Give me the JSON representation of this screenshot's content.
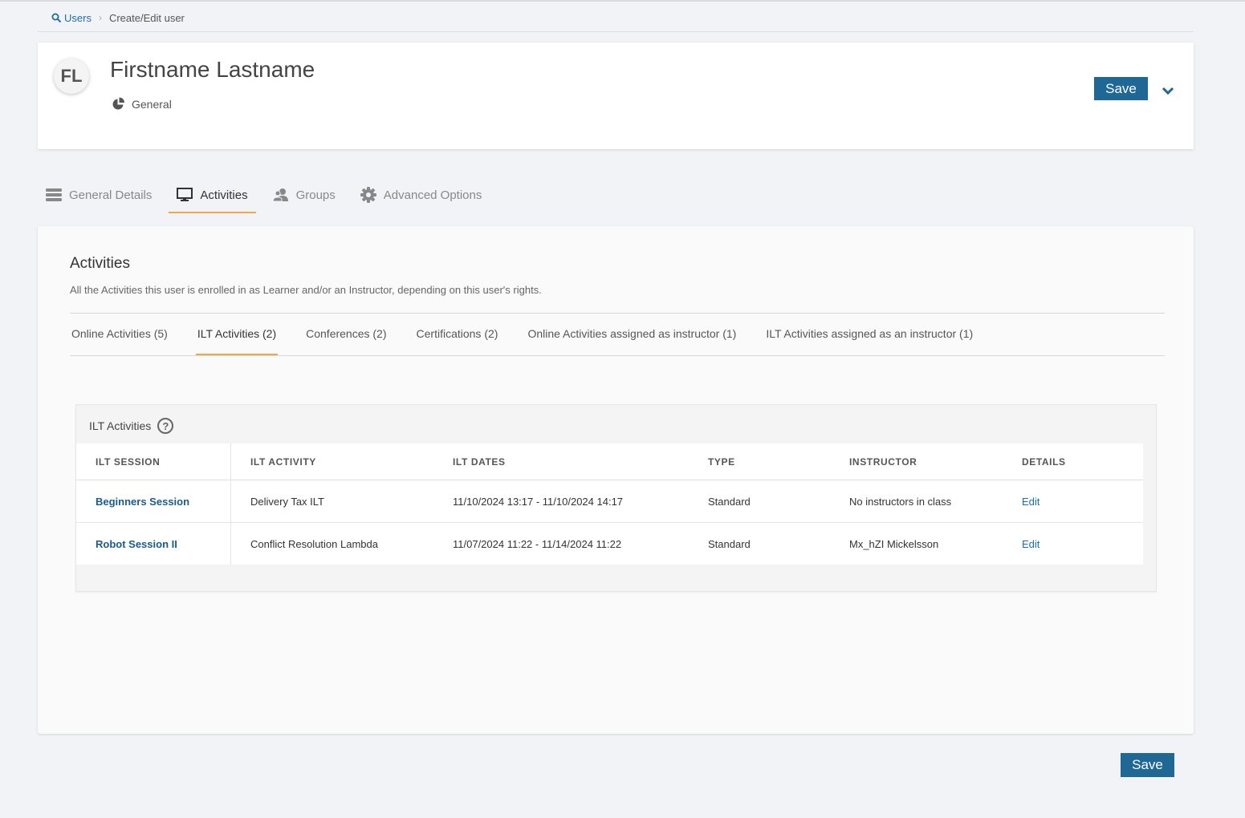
{
  "breadcrumb": {
    "root": "Users",
    "current": "Create/Edit user"
  },
  "user": {
    "initials": "FL",
    "name": "Firstname Lastname",
    "type": "General"
  },
  "header": {
    "save_label": "Save"
  },
  "main_tabs": [
    {
      "label": "General Details",
      "icon": "list-icon"
    },
    {
      "label": "Activities",
      "icon": "monitor-icon"
    },
    {
      "label": "Groups",
      "icon": "users-icon"
    },
    {
      "label": "Advanced Options",
      "icon": "gear-icon"
    }
  ],
  "activities": {
    "title": "Activities",
    "description": "All the Activities this user is enrolled in as Learner and/or an Instructor, depending on this user's rights.",
    "sub_tabs": [
      "Online Activities (5)",
      "ILT Activities (2)",
      "Conferences (2)",
      "Certifications (2)",
      "Online Activities assigned as instructor (1)",
      "ILT Activities assigned as an instructor (1)"
    ],
    "ilt": {
      "heading": "ILT Activities",
      "help_glyph": "?",
      "columns": [
        "ILT SESSION",
        "ILT ACTIVITY",
        "ILT DATES",
        "TYPE",
        "INSTRUCTOR",
        "DETAILS"
      ],
      "rows": [
        {
          "session": "Beginners Session",
          "activity": "Delivery Tax ILT",
          "dates": "11/10/2024 13:17 - 11/10/2024 14:17",
          "type": "Standard",
          "instructor": "No instructors in class",
          "details": "Edit"
        },
        {
          "session": "Robot Session II",
          "activity": "Conflict Resolution Lambda",
          "dates": "11/07/2024 11:22 - 11/14/2024 11:22",
          "type": "Standard",
          "instructor": "Mx_hZI Mickelsson",
          "details": "Edit"
        }
      ]
    }
  },
  "footer": {
    "save_label": "Save"
  },
  "colors": {
    "primary": "#1f6896",
    "tab_underline": "#f0a64a",
    "link": "#1a6fa8"
  }
}
